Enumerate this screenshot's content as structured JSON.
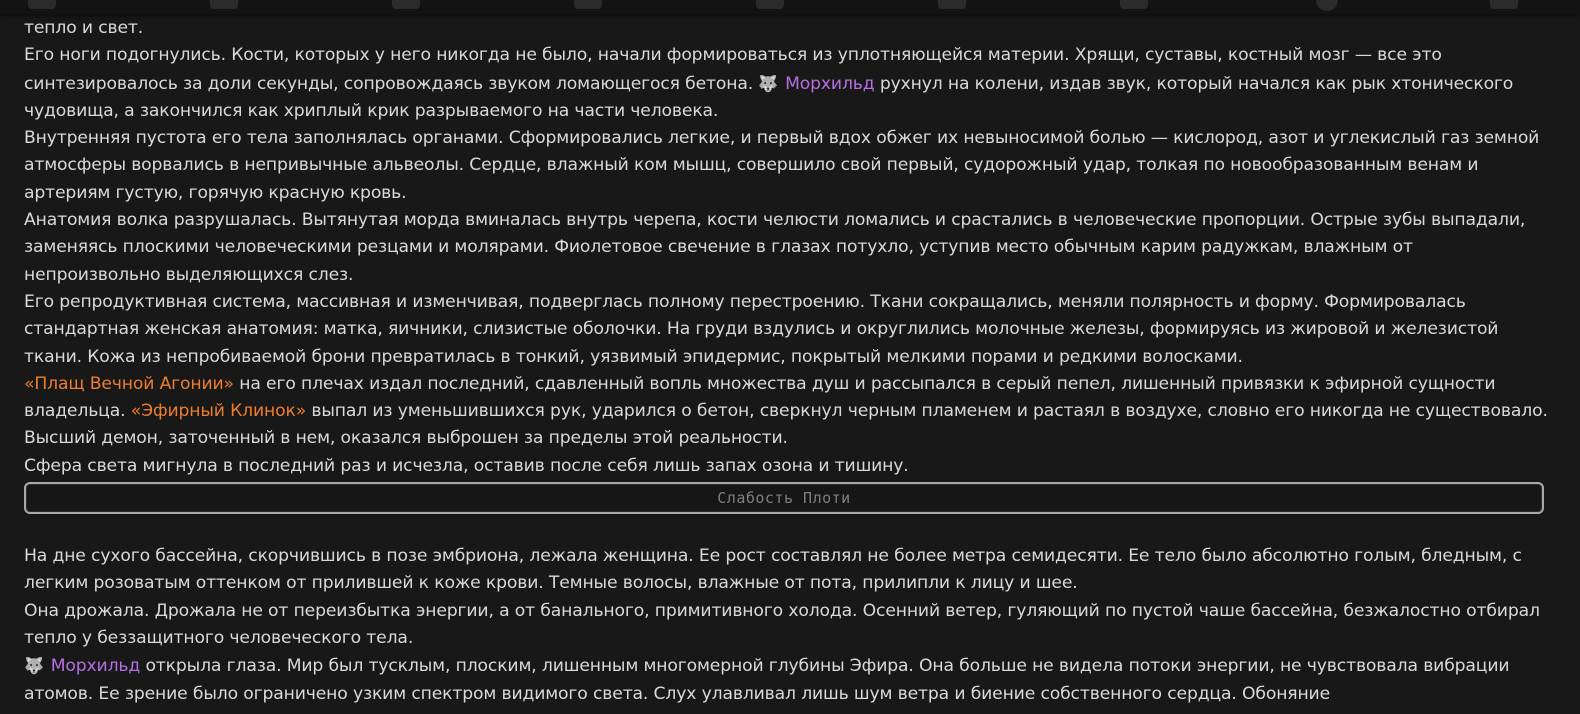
{
  "paragraphs_top": [
    {
      "segments": [
        {
          "t": "тепло и свет."
        }
      ]
    },
    {
      "segments": [
        {
          "t": "Его ноги подогнулись. Кости, которых у него никогда не было, начали формироваться из уплотняющейся материи. Хрящи, суставы, костный мозг — все это синтезировалось за доли секунды, сопровождаясь звуком ломающегося бетона. "
        },
        {
          "t": "🐺 ",
          "c": "wolf"
        },
        {
          "t": "Морхильд",
          "c": "name-purple"
        },
        {
          "t": " рухнул на колени, издав звук, который начался как рык хтонического чудовища, а закончился как хриплый крик разрываемого на части человека."
        }
      ]
    },
    {
      "segments": [
        {
          "t": "Внутренняя пустота его тела заполнялась органами. Сформировались легкие, и первый вдох обжег их невыносимой болью — кислород, азот и углекислый газ земной атмосферы ворвались в непривычные альвеолы. Сердце, влажный ком мышц, совершило свой первый, судорожный удар, толкая по новообразованным венам и артериям густую, горячую красную кровь."
        }
      ]
    },
    {
      "segments": [
        {
          "t": "Анатомия волка разрушалась. Вытянутая морда вминалась внутрь черепа, кости челюсти ломались и срастались в человеческие пропорции. Острые зубы выпадали, заменяясь плоскими человеческими резцами и молярами. Фиолетовое свечение в глазах потухло, уступив место обычным карим радужкам, влажным от непроизвольно выделяющихся слез."
        }
      ]
    },
    {
      "segments": [
        {
          "t": "Его репродуктивная система, массивная и изменчивая, подверглась полному перестроению. Ткани сокращались, меняли полярность и форму. Формировалась стандартная женская анатомия: матка, яичники, слизистые оболочки. На груди вздулись и округлились молочные железы, формируясь из жировой и железистой ткани. Кожа из непробиваемой брони превратилась в тонкий, уязвимый эпидермис, покрытый мелкими порами и редкими волосками."
        }
      ]
    },
    {
      "segments": [
        {
          "t": "«Плащ Вечной Агонии»",
          "c": "item-orange"
        },
        {
          "t": " на его плечах издал последний, сдавленный вопль множества душ и рассыпался в серый пепел, лишенный привязки к эфирной сущности владельца. "
        },
        {
          "t": "«Эфирный Клинок»",
          "c": "item-orange"
        },
        {
          "t": " выпал из уменьшившихся рук, ударился о бетон, сверкнул черным пламенем и растаял в воздухе, словно его никогда не существовало. Высший демон, заточенный в нем, оказался выброшен за пределы этой реальности."
        }
      ]
    },
    {
      "segments": [
        {
          "t": "Сфера света мигнула в последний раз и исчезла, оставив после себя лишь запах озона и тишину."
        }
      ]
    }
  ],
  "chapter_divider": {
    "title": "Слабость Плоти"
  },
  "paragraphs_bottom": [
    {
      "segments": [
        {
          "t": "На дне сухого бассейна, скорчившись в позе эмбриона, лежала женщина. Ее рост составлял не более метра семидесяти. Ее тело было абсолютно голым, бледным, с легким розоватым оттенком от прилившей к коже крови. Темные волосы, влажные от пота, прилипли к лицу и шее."
        }
      ]
    },
    {
      "segments": [
        {
          "t": "Она дрожала. Дрожала не от переизбытка энергии, а от банального, примитивного холода. Осенний ветер, гуляющий по пустой чаше бассейна, безжалостно отбирал тепло у беззащитного человеческого тела."
        }
      ]
    },
    {
      "segments": [
        {
          "t": "🐺 ",
          "c": "wolf"
        },
        {
          "t": "Морхильд",
          "c": "name-purple"
        },
        {
          "t": " открыла глаза. Мир был тусклым, плоским, лишенным многомерной глубины Эфира. Она больше не видела потоки энергии, не чувствовала вибрации атомов. Ее зрение было ограничено узким спектром видимого света. Слух улавливал лишь шум ветра и биение собственного сердца. Обоняние"
        }
      ]
    }
  ],
  "colors": {
    "background": "#181818",
    "text": "#d9d9d9",
    "character_name": "#b56fe0",
    "item_name": "#ee7d2f",
    "divider_border": "#a9a9a9",
    "divider_text": "#7f7f7f"
  },
  "toolbar_icons": [
    "tool-icon",
    "pin-icon",
    "network-icon",
    "chat-icon",
    "puzzle-icon",
    "book-icon",
    "box-icon",
    "compass-icon",
    "folder-icon"
  ]
}
